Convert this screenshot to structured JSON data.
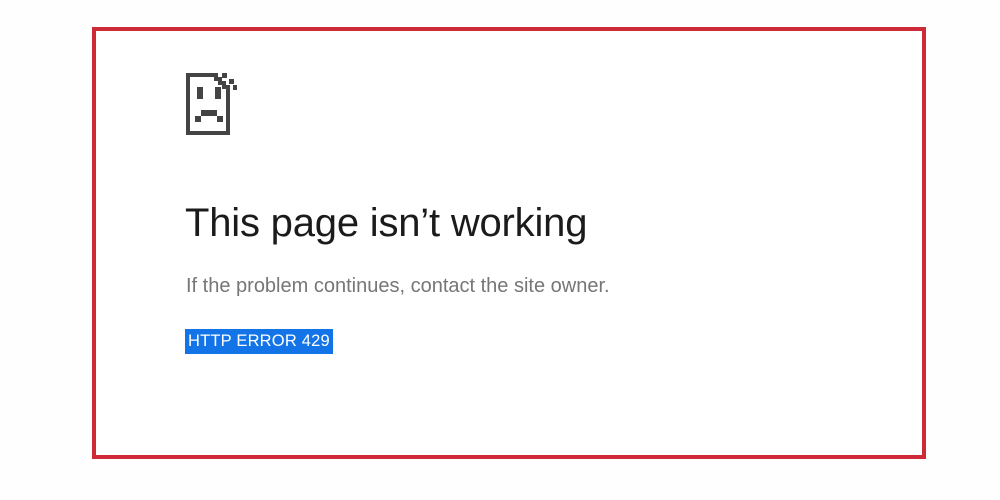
{
  "page": {
    "background_color": "#fefefe",
    "content_background_color": "#ffffff"
  },
  "annotation": {
    "name": "red-highlight-rectangle",
    "border_color": "#cd2936",
    "border_width_px": 4
  },
  "error": {
    "icon_name": "sad-page-icon",
    "icon_color": "#444444",
    "title": "This page isn’t working",
    "title_color": "#1b1b1b",
    "subtitle": "If the problem continues, contact the site owner.",
    "subtitle_color": "#767676",
    "error_code": "HTTP ERROR 429",
    "error_code_text_color": "#ffffff",
    "error_code_selection_color": "#1374e8",
    "error_code_selected": true
  }
}
